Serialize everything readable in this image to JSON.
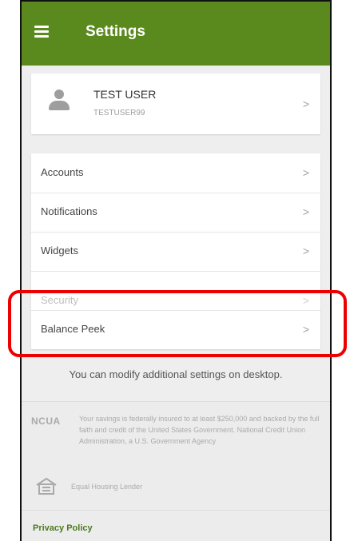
{
  "header": {
    "title": "Settings"
  },
  "profile": {
    "name": "TEST USER",
    "username": "TESTUSER99"
  },
  "menu": [
    {
      "label": "Accounts"
    },
    {
      "label": "Notifications"
    },
    {
      "label": "Widgets"
    },
    {
      "label": "Security"
    },
    {
      "label": "Balance Peek"
    }
  ],
  "chevron": ">",
  "desktop_note": "You can modify additional settings on desktop.",
  "footer": {
    "ncua_logo": "NCUA",
    "ncua_text": "Your savings is federally insured to at least $250,000 and backed by the full faith and credit of the United States Government. National Credit Union Administration, a U.S. Government Agency",
    "equal_housing": "Equal Housing Lender",
    "privacy": "Privacy Policy"
  },
  "colors": {
    "brand": "#5a8a1e",
    "highlight": "#ee0000"
  }
}
